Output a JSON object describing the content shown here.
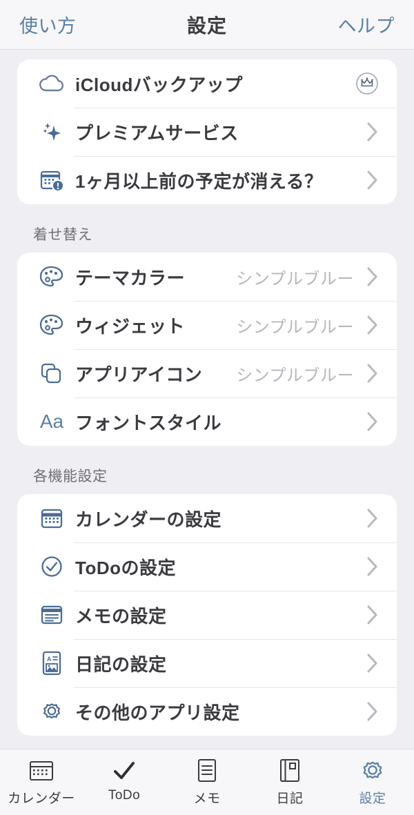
{
  "header": {
    "left_label": "使い方",
    "title": "設定",
    "right_label": "ヘルプ",
    "accent_color": "#5B7FA6"
  },
  "colors": {
    "background": "#EFEFF3",
    "card": "#FFFFFF",
    "icon_blue": "#4A6C96",
    "text": "#3A3A3F",
    "muted": "#B6B6BC",
    "chevron": "#B8B8BE"
  },
  "sections": [
    {
      "title": "",
      "rows": [
        {
          "label": "iCloudバックアップ",
          "value": "",
          "icon": "cloud-icon",
          "accessory": "crown-badge"
        },
        {
          "label": "プレミアムサービス",
          "value": "",
          "icon": "sparkle-icon",
          "accessory": "chevron"
        },
        {
          "label": "1ヶ月以上前の予定が消える？",
          "value": "",
          "icon": "calendar-alert-icon",
          "accessory": "chevron"
        }
      ]
    },
    {
      "title": "着せ替え",
      "rows": [
        {
          "label": "テーマカラー",
          "value": "シンプルブルー",
          "icon": "palette-icon",
          "accessory": "chevron"
        },
        {
          "label": "ウィジェット",
          "value": "シンプルブルー",
          "icon": "palette-icon",
          "accessory": "chevron"
        },
        {
          "label": "アプリアイコン",
          "value": "シンプルブルー",
          "icon": "app-icon-squares-icon",
          "accessory": "chevron"
        },
        {
          "label": "フォントスタイル",
          "value": "",
          "icon": "font-aa-icon",
          "accessory": "chevron"
        }
      ]
    },
    {
      "title": "各機能設定",
      "rows": [
        {
          "label": "カレンダーの設定",
          "value": "",
          "icon": "calendar-icon",
          "accessory": "chevron"
        },
        {
          "label": "ToDoの設定",
          "value": "",
          "icon": "check-circle-icon",
          "accessory": "chevron"
        },
        {
          "label": "メモの設定",
          "value": "",
          "icon": "note-icon",
          "accessory": "chevron"
        },
        {
          "label": "日記の設定",
          "value": "",
          "icon": "diary-icon",
          "accessory": "chevron"
        },
        {
          "label": "その他のアプリ設定",
          "value": "",
          "icon": "gear-icon",
          "accessory": "chevron"
        }
      ]
    }
  ],
  "tabbar": {
    "tabs": [
      {
        "label": "カレンダー",
        "icon": "calendar-icon",
        "active": false
      },
      {
        "label": "ToDo",
        "icon": "check-icon",
        "active": false
      },
      {
        "label": "メモ",
        "icon": "note-lines-icon",
        "active": false
      },
      {
        "label": "日記",
        "icon": "book-icon",
        "active": false
      },
      {
        "label": "設定",
        "icon": "gear-icon",
        "active": true
      }
    ]
  }
}
